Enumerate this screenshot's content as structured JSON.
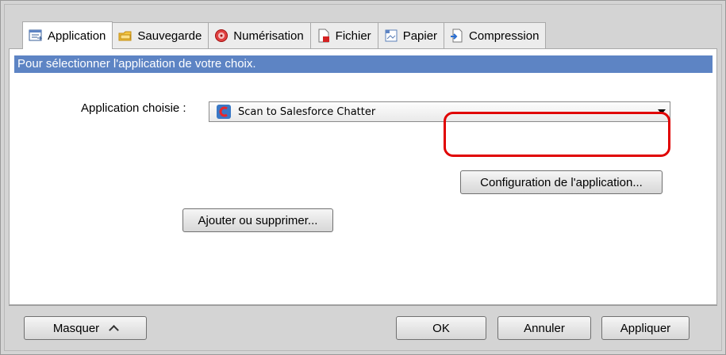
{
  "tabs": [
    {
      "label": "Application",
      "icon": "application-icon",
      "active": true
    },
    {
      "label": "Sauvegarde",
      "icon": "folder-icon",
      "active": false
    },
    {
      "label": "Numérisation",
      "icon": "scan-icon",
      "active": false
    },
    {
      "label": "Fichier",
      "icon": "file-icon",
      "active": false
    },
    {
      "label": "Papier",
      "icon": "paper-icon",
      "active": false
    },
    {
      "label": "Compression",
      "icon": "compression-icon",
      "active": false
    }
  ],
  "panel": {
    "banner": "Pour sélectionner l'application de votre choix.",
    "app_label": "Application choisie :",
    "app_selected": "Scan to Salesforce Chatter",
    "config_button": "Configuration de l'application...",
    "add_remove_button": "Ajouter ou supprimer..."
  },
  "footer": {
    "hide_button": "Masquer",
    "ok_button": "OK",
    "cancel_button": "Annuler",
    "apply_button": "Appliquer"
  },
  "colors": {
    "banner_bg": "#5d84c4",
    "highlight": "#e00000",
    "dialog_bg": "#d4d4d4"
  }
}
